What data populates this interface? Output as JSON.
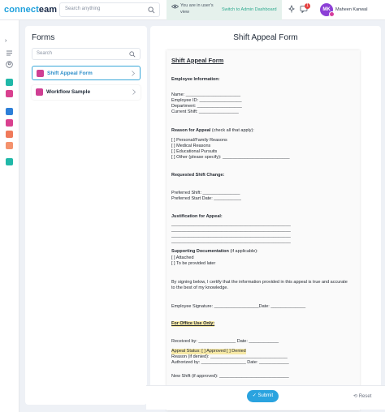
{
  "app": {
    "logo_part1": "connect",
    "logo_part2": "eam",
    "search_placeholder": "Search anything",
    "user_view_line1": "You are in user's",
    "user_view_line2": "view",
    "switch_label": "Switch to Admin Dashboard",
    "notification_count": "1",
    "avatar_initials": "MK",
    "user_name": "Maheen Kanwal"
  },
  "forms_panel": {
    "title": "Forms",
    "search_placeholder": "Search",
    "items": [
      {
        "label": "Shift Appeal Form",
        "active": true
      },
      {
        "label": "Workflow Sample",
        "active": false
      }
    ]
  },
  "main": {
    "title": "Shift Appeal Form",
    "submit_label": "Submit",
    "reset_label": "Reset"
  },
  "document": {
    "doc_title": "Shift Appeal Form",
    "employee_info": "Employee Information:",
    "name_field": "Name: ______________________",
    "employee_id_field": "Employee ID: _________________",
    "department_field": "Department: __________________",
    "current_shift_field": "Current Shift: ________________",
    "reason_heading": "Reason for Appeal",
    "reason_hint": "(check all that apply):",
    "reason_options": [
      "[ ] Personal/Family Reasons",
      "[ ] Medical Reasons",
      "[ ] Educational Pursuits",
      "[ ] Other (please specify): ___________________________"
    ],
    "requested_heading": "Requested Shift Change:",
    "preferred_shift": "Preferred Shift: _______________",
    "preferred_start": "Preferred Start Date: ___________",
    "justification_heading": "Justification for Appeal:",
    "justification_lines": [
      "________________________________________________",
      "________________________________________________",
      "________________________________________________",
      "________________________________________________"
    ],
    "supporting_heading": "Supporting Documentation",
    "supporting_hint": "(if applicable):",
    "supporting_options": [
      "[ ] Attached",
      "[ ] To be provided later"
    ],
    "certify_line1": "By signing below, I certify that the information provided in this appeal is true and accurate",
    "certify_line2": "to the best of my knowledge.",
    "signature_line": "Employee Signature: __________________Date: ______________",
    "office_heading": "For Office Use Only:",
    "received_line": "Received by: _______________   Date: ____________",
    "appeal_status": "Appeal Status: [ ] Approved  [ ] Denied",
    "reason_if_denied": "Reason (if denied): _______________________________",
    "authorized_line": "Authorized by: __________________  Date: ____________",
    "new_shift_line": "New Shift (if approved): ____________________________"
  }
}
